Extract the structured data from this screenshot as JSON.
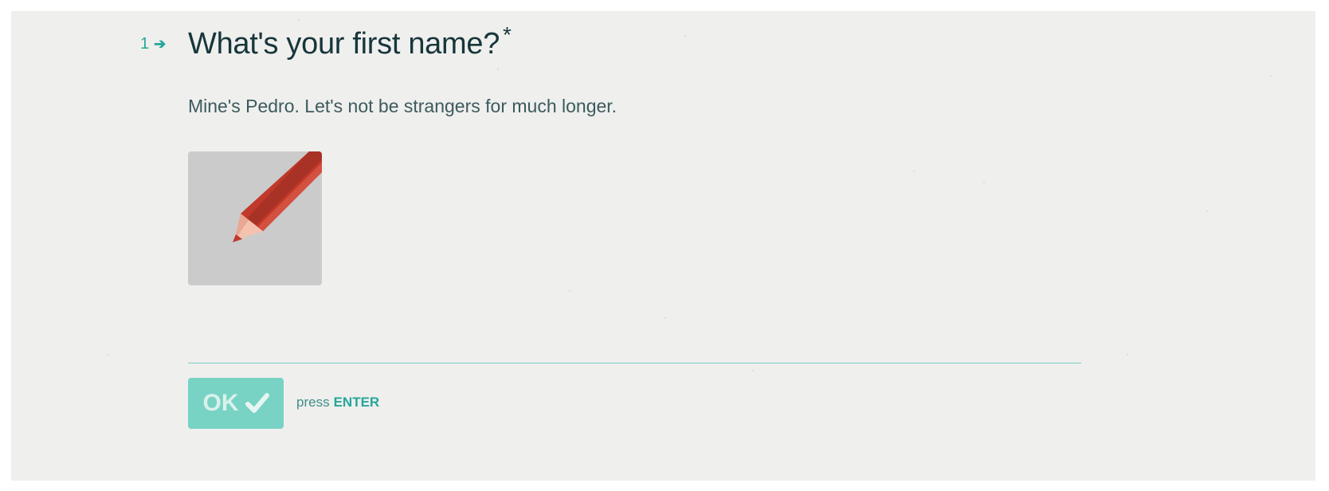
{
  "question": {
    "number": "1",
    "arrow_icon": "arrow-right-icon",
    "title": "What's your first name?",
    "required_mark": "*",
    "description": "Mine's Pedro. Let's not be strangers for much longer.",
    "image_icon": "pencil-icon"
  },
  "answer": {
    "value": "",
    "placeholder": ""
  },
  "actions": {
    "ok_label": "OK",
    "ok_icon": "check-icon",
    "hint_prefix": "press",
    "hint_key": "ENTER"
  },
  "colors": {
    "background": "#efefee",
    "accent": "#26a69a",
    "button": "#78d3c4",
    "title_text": "#17363a",
    "pencil_body": "#c0392b"
  }
}
